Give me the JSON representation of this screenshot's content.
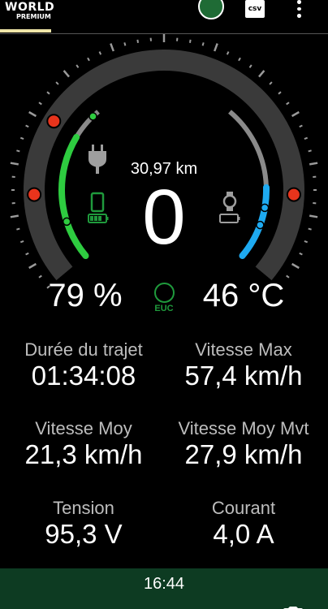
{
  "app": {
    "logo_main": "WORLD",
    "logo_sub": "PREMIUM"
  },
  "toolbar": {
    "csv_label": "csv",
    "connect_icon": "connection-status-icon",
    "menu_icon": "overflow-menu-icon"
  },
  "gauge": {
    "distance": "30,97 km",
    "speed": "0",
    "battery": "79 %",
    "temperature": "46 °C",
    "battery_level": 0.79,
    "temperature_level": 0.46,
    "euc_label": "EUC",
    "colors": {
      "battery_arc": "#2ecc40",
      "temperature_arc": "#1eaaf1",
      "marker": "#e8341c",
      "track": "#3a3a3a",
      "phone_icon": "#1f9a3c",
      "watch_icon": "#9e9e9e"
    }
  },
  "stats": [
    {
      "label": "Durée du trajet",
      "value": "01:34:08"
    },
    {
      "label": "Vitesse Max",
      "value": "57,4 km/h"
    },
    {
      "label": "Vitesse Moy",
      "value": "21,3 km/h"
    },
    {
      "label": "Vitesse Moy Mvt",
      "value": "27,9 km/h"
    },
    {
      "label": "Tension",
      "value": "95,3 V"
    },
    {
      "label": "Courant",
      "value": "4,0 A"
    }
  ],
  "footer": {
    "time": "16:44",
    "background": "#0d3b22",
    "camera_icon": "camera-icon"
  }
}
